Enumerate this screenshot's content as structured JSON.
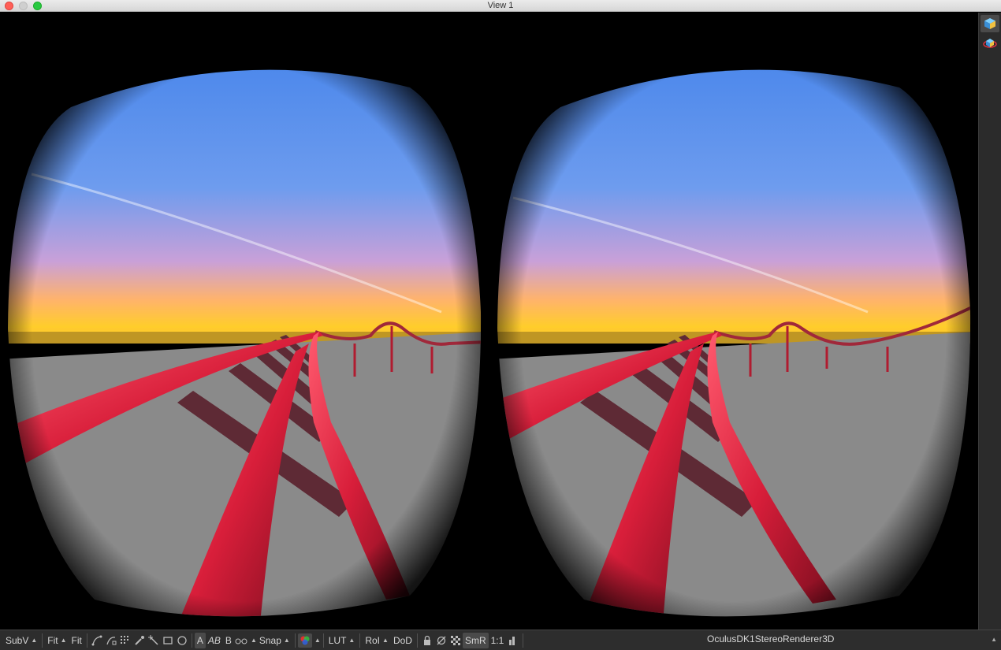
{
  "window": {
    "title": "View 1"
  },
  "viewport": {
    "left_eye": "left-eye-view",
    "right_eye": "right-eye-view"
  },
  "side_strip": {
    "icons": [
      "3d-cube-icon",
      "3d-cube-eye-icon"
    ]
  },
  "toolbar": {
    "subview": "SubV",
    "fit1": "Fit",
    "fit2": "Fit",
    "snap": "Snap",
    "lut": "LUT",
    "roi": "RoI",
    "dod": "DoD",
    "smr": "SmR",
    "ratio": "1:1",
    "a_label": "A",
    "ab_label": "AB",
    "b_label": "B",
    "status": "OculusDK1StereoRenderer3D"
  },
  "colors": {
    "rail": "#d81e3a",
    "sky_top": "#3f80ea",
    "horizon": "#ffd21f",
    "ground": "#8a8a8a"
  }
}
